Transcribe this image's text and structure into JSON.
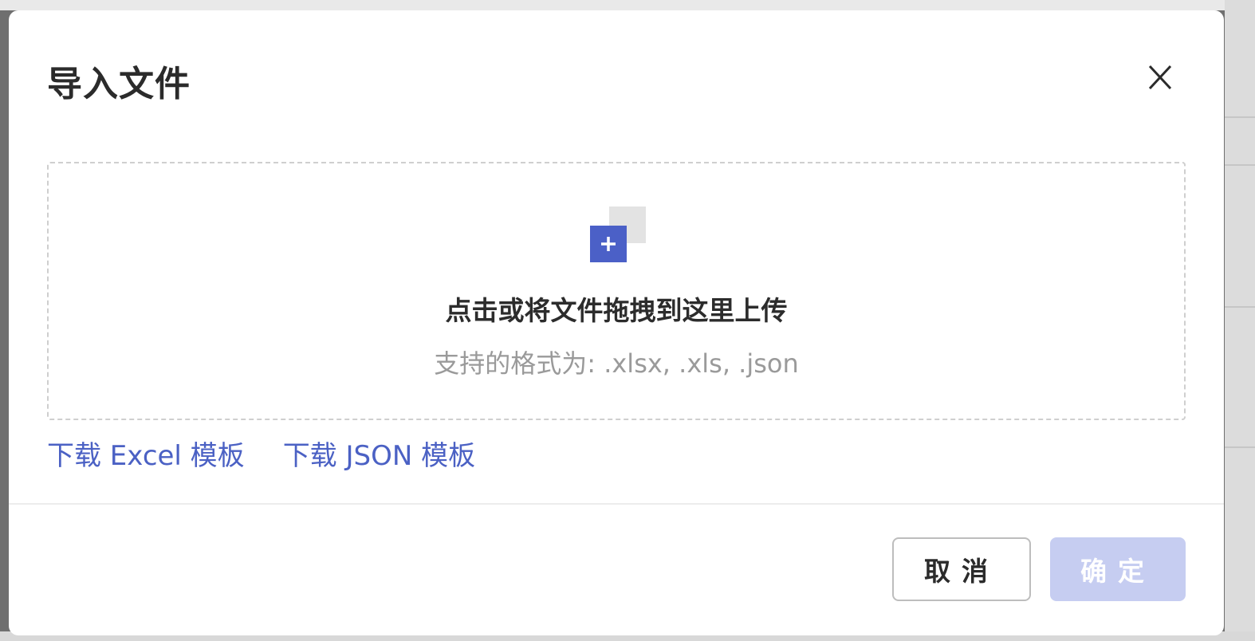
{
  "dialog": {
    "title": "导入文件",
    "close_icon": "close-icon"
  },
  "dropzone": {
    "icon": "add-file-icon",
    "primary_text": "点击或将文件拖拽到这里上传",
    "hint_text": "支持的格式为: .xlsx, .xls, .json"
  },
  "templates": {
    "excel_label": "下载 Excel 模板",
    "json_label": "下载 JSON 模板"
  },
  "footer": {
    "cancel_label": "取消",
    "confirm_label": "确定",
    "confirm_state": "disabled"
  },
  "colors": {
    "accent": "#4b60c7",
    "link": "#4b61c4",
    "confirm_disabled_bg": "#c6cdf1"
  }
}
